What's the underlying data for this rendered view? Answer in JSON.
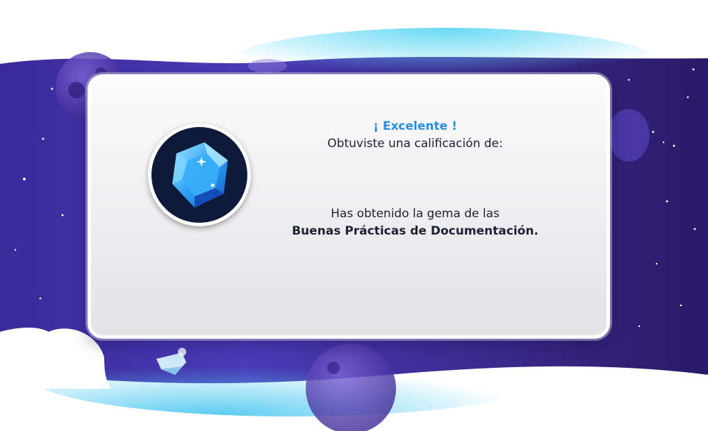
{
  "dialog": {
    "title": "¡ Excelente !",
    "subtitle": "Obtuviste una calificación de:",
    "gem_line1": "Has obtenido la gema de las",
    "gem_line2": "Buenas Prácticas de Documentación."
  },
  "icons": {
    "badge": "blue-gem-icon",
    "decorative_gem": "floating-crystal-icon"
  },
  "colors": {
    "title": "#2a8ee0",
    "text": "#1c2233",
    "badge_bg": "#0f1a3a",
    "space_dark": "#2b1a6e",
    "space_light": "#56c6ef"
  }
}
